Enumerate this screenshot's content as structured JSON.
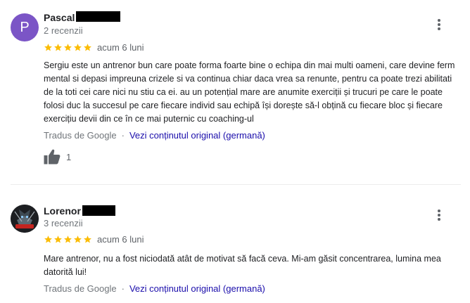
{
  "colors": {
    "star": "#fbbc04",
    "link": "#1a0dab",
    "avatar_p": "#7b55c6"
  },
  "reviews": [
    {
      "author": "Pascal",
      "avatar_letter": "P",
      "review_count": "2 recenzii",
      "rating": 5,
      "time": "acum 6 luni",
      "text": "Sergiu este un antrenor bun care poate forma foarte bine o echipa din mai multi oameni, care devine ferm mental si depasi impreuna crizele si va continua chiar daca vrea sa renunte, pentru ca poate trezi abilitati de la toti cei care nici nu stiu ca ei. au un potențial mare are anumite exerciții și trucuri pe care le poate folosi duc la succesul pe care fiecare individ sau echipă își dorește să-l obțină cu fiecare bloc și fiecare exercițiu devii din ce în ce mai puternic cu coaching-ul",
      "translated_by": "Tradus de Google",
      "separator": "·",
      "original_link": "Vezi conținutul original (germană)",
      "likes": "1",
      "icons": [
        "more-vert-icon",
        "star-icon",
        "thumb-up-icon"
      ]
    },
    {
      "author": "Lorenor",
      "avatar_caption": "Lorenor",
      "review_count": "3 recenzii",
      "rating": 5,
      "time": "acum 6 luni",
      "text": "Mare antrenor, nu a fost niciodată atât de motivat să facă ceva. Mi-am găsit concentrarea, lumina mea datorită lui!",
      "translated_by": "Tradus de Google",
      "separator": "·",
      "original_link": "Vezi conținutul original (germană)",
      "icons": [
        "more-vert-icon",
        "star-icon"
      ]
    }
  ]
}
